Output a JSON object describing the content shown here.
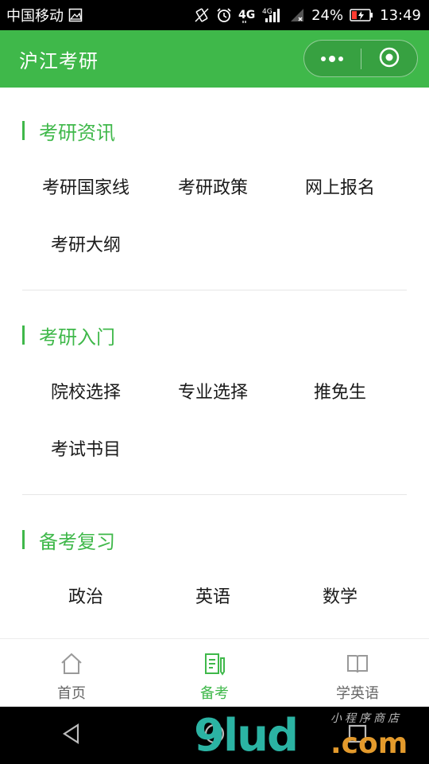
{
  "status_bar": {
    "carrier": "中国移动",
    "battery": "24%",
    "time": "13:49",
    "icons": [
      "image-icon",
      "vibrate-icon",
      "alarm-icon",
      "4g-icon",
      "signal-icon",
      "battery-icon"
    ]
  },
  "app_bar": {
    "title": "沪江考研",
    "menu_icon": "more-dots-icon",
    "close_icon": "target-close-icon"
  },
  "sections": [
    {
      "title": "考研资讯",
      "items": [
        "考研国家线",
        "考研政策",
        "网上报名",
        "考研大纲"
      ]
    },
    {
      "title": "考研入门",
      "items": [
        "院校选择",
        "专业选择",
        "推免生",
        "考试书目"
      ]
    },
    {
      "title": "备考复习",
      "items": [
        "政治",
        "英语",
        "数学"
      ]
    }
  ],
  "tab_bar": {
    "tabs": [
      {
        "label": "首页",
        "icon": "home-icon",
        "active": false
      },
      {
        "label": "备考",
        "icon": "notes-icon",
        "active": true
      },
      {
        "label": "学英语",
        "icon": "book-icon",
        "active": false
      }
    ],
    "active_color": "#3fb84a",
    "inactive_color": "#666666"
  },
  "nav_bar": {
    "buttons": [
      "back-triangle-icon",
      "home-circle-icon",
      "recents-square-icon"
    ]
  },
  "watermark": {
    "main": "9lud",
    "suffix": ".com",
    "small": "小程序商店"
  },
  "colors": {
    "brand_green": "#3fb84a",
    "text": "#1a1a1a",
    "divider": "#e6e6e6"
  }
}
